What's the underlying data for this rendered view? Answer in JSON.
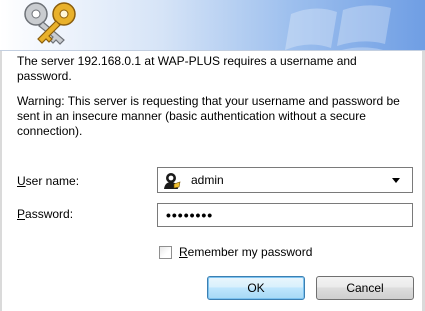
{
  "dialog": {
    "prompt_text": "The server 192.168.0.1 at WAP-PLUS requires a username and password.",
    "warning_text": "Warning: This server is requesting that your username and password be sent in an insecure manner (basic authentication without a secure connection)."
  },
  "fields": {
    "username_label_accel": "U",
    "username_label_rest": "ser name:",
    "username_value": "admin",
    "password_label_accel": "P",
    "password_label_rest": "assword:",
    "password_value": "••••••••"
  },
  "remember": {
    "label_accel": "R",
    "label_rest": "emember my password",
    "checked": false
  },
  "buttons": {
    "ok_label": "OK",
    "cancel_label": "Cancel"
  },
  "colors": {
    "banner_accent": "#6f9ee4",
    "key_gold": "#e9b12b",
    "default_button_border": "#3c7fb1"
  },
  "icons": {
    "banner": "keys-icon",
    "user": "user-account-icon",
    "dropdown": "chevron-down-icon"
  }
}
